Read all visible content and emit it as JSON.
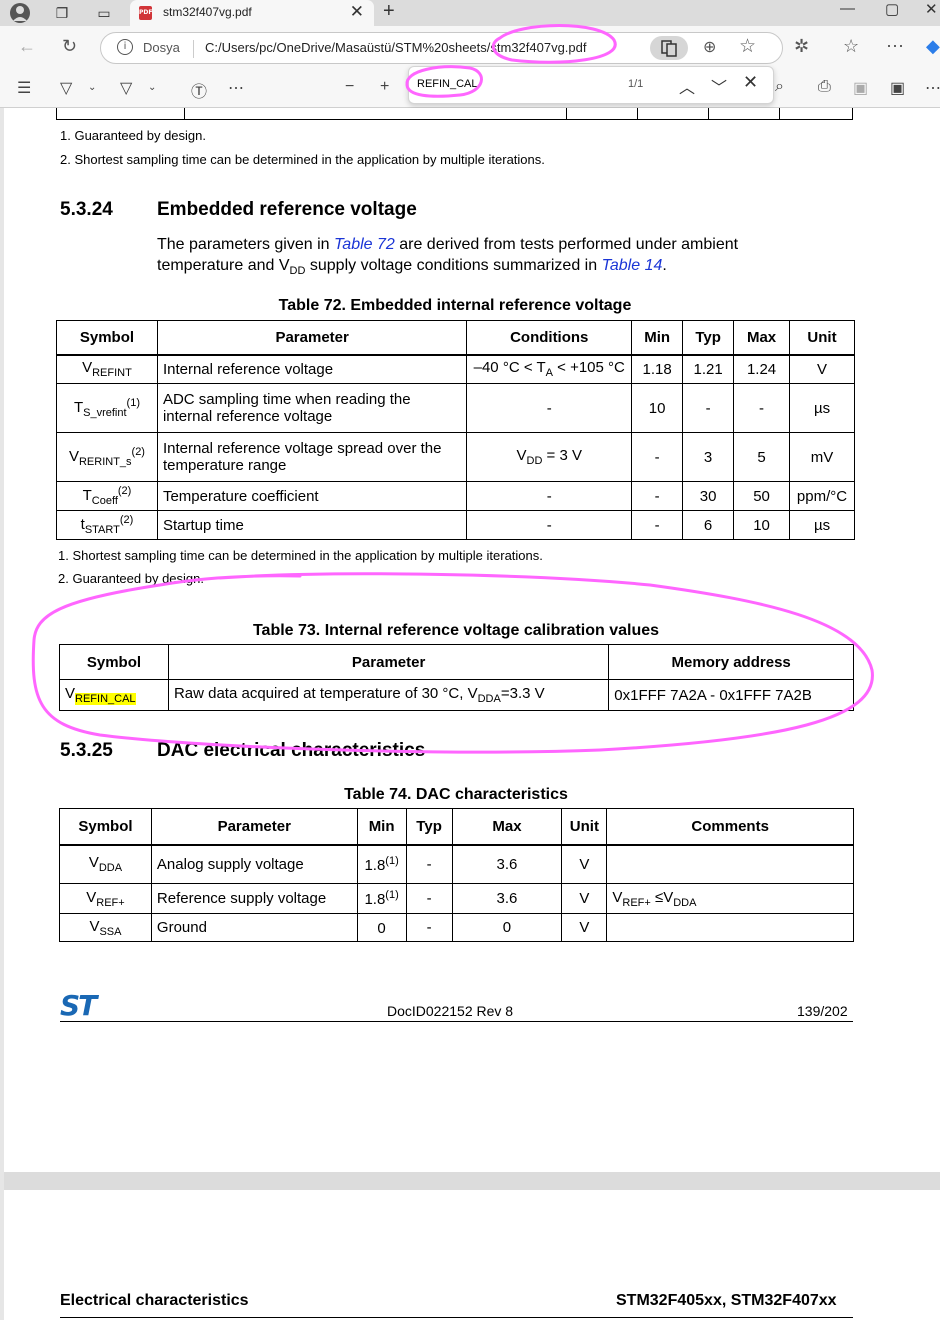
{
  "browser": {
    "tab_title": "stm32f407vg.pdf",
    "tab_icon_label": "PDF",
    "site_label": "Dosya",
    "url": "C:/Users/pc/OneDrive/Masaüstü/STM%20sheets/stm32f407vg.pdf"
  },
  "find": {
    "query": "REFIN_CAL",
    "count": "1/1"
  },
  "prev_table_footnotes": [
    "1.   Guaranteed by design.",
    "2.   Shortest sampling time can be determined in the application by multiple iterations."
  ],
  "section_5324": {
    "number": "5.3.24",
    "title": "Embedded reference voltage",
    "para_a": "The parameters given in ",
    "para_link1": "Table 72",
    "para_b": " are derived from tests performed under ambient",
    "para_c": "temperature and V",
    "para_sub": "DD",
    "para_d": " supply voltage conditions summarized in ",
    "para_link2": "Table 14",
    "para_e": "."
  },
  "table72": {
    "caption": "Table 72. Embedded internal reference voltage",
    "headers": [
      "Symbol",
      "Parameter",
      "Conditions",
      "Min",
      "Typ",
      "Max",
      "Unit"
    ],
    "rows": [
      {
        "sym": "V",
        "sub": "REFINT",
        "sup": "",
        "param": "Internal reference voltage",
        "cond": "–40 °C < T",
        "cond_sub": "A",
        "cond2": " < +105 °C",
        "min": "1.18",
        "typ": "1.21",
        "max": "1.24",
        "unit": "V"
      },
      {
        "sym": "T",
        "sub": "S_vrefint",
        "sup": "(1)",
        "param": "ADC sampling time when reading the internal reference voltage",
        "cond": "-",
        "cond_sub": "",
        "cond2": "",
        "min": "10",
        "typ": "-",
        "max": "-",
        "unit": "µs"
      },
      {
        "sym": "V",
        "sub": "RERINT_s",
        "sup": "(2)",
        "param": "Internal reference voltage spread over the temperature range",
        "cond": "V",
        "cond_sub": "DD",
        "cond2": " = 3 V",
        "min": "-",
        "typ": "3",
        "max": "5",
        "unit": "mV"
      },
      {
        "sym": "T",
        "sub": "Coeff",
        "sup": "(2)",
        "param": "Temperature coefficient",
        "cond": "-",
        "cond_sub": "",
        "cond2": "",
        "min": "-",
        "typ": "30",
        "max": "50",
        "unit": "ppm/°C"
      },
      {
        "sym": "t",
        "sub": "START",
        "sup": "(2)",
        "param": "Startup time",
        "cond": "-",
        "cond_sub": "",
        "cond2": "",
        "min": "-",
        "typ": "6",
        "max": "10",
        "unit": "µs"
      }
    ],
    "footnotes": [
      "1.   Shortest sampling time can be determined in the application by multiple iterations.",
      "2.   Guaranteed by design."
    ]
  },
  "table73": {
    "caption": "Table 73. Internal reference voltage calibration values",
    "headers": [
      "Symbol",
      "Parameter",
      "Memory address"
    ],
    "row": {
      "sym": "V",
      "sub": "REFIN_CAL",
      "param_a": "Raw data acquired at temperature of 30 °C, V",
      "param_sub": "DDA",
      "param_b": "=3.3 V",
      "addr": "0x1FFF 7A2A - 0x1FFF 7A2B"
    }
  },
  "section_5325": {
    "number": "5.3.25",
    "title": "DAC electrical characteristics"
  },
  "table74": {
    "caption": "Table 74. DAC characteristics",
    "headers": [
      "Symbol",
      "Parameter",
      "Min",
      "Typ",
      "Max",
      "Unit",
      "Comments"
    ],
    "rows": [
      {
        "sym": "V",
        "sub": "DDA",
        "param": "Analog supply voltage",
        "min": "1.8",
        "min_sup": "(1)",
        "typ": "-",
        "max": "3.6",
        "unit": "V",
        "cmt": "",
        "cmt_sub": "",
        "cmt2": "",
        "cmt_sub2": ""
      },
      {
        "sym": "V",
        "sub": "REF+",
        "param": "Reference supply voltage",
        "min": "1.8",
        "min_sup": "(1)",
        "typ": "-",
        "max": "3.6",
        "unit": "V",
        "cmt": "V",
        "cmt_sub": "REF+",
        "cmt2": " ≤V",
        "cmt_sub2": "DDA"
      },
      {
        "sym": "V",
        "sub": "SSA",
        "param": "Ground",
        "min": "0",
        "min_sup": "",
        "typ": "-",
        "max": "0",
        "unit": "V",
        "cmt": "",
        "cmt_sub": "",
        "cmt2": "",
        "cmt_sub2": ""
      }
    ]
  },
  "footer": {
    "logo": "ST",
    "doc_id": "DocID022152 Rev 8",
    "page": "139/202"
  },
  "next_page_header": {
    "left": "Electrical characteristics",
    "right": "STM32F405xx, STM32F407xx"
  },
  "colors": {
    "annotation": "#ff66ff",
    "highlight": "#ffff00",
    "link": "#1a35d6",
    "st_blue": "#1a68b4"
  }
}
